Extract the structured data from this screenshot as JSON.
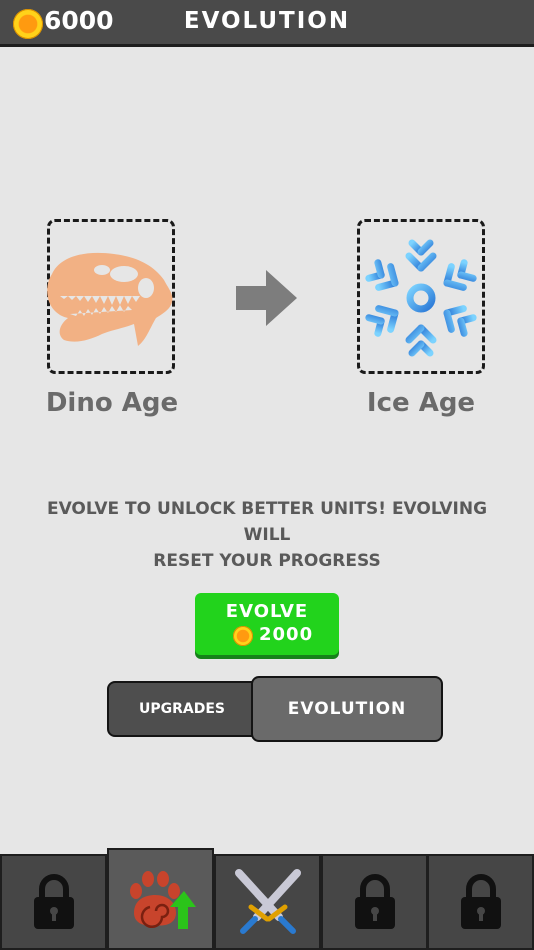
{
  "header": {
    "coins": "6000",
    "title": "EVOLUTION"
  },
  "evolution": {
    "current_age": "Dino Age",
    "next_age": "Ice Age",
    "message_line1": "EVOLVE TO UNLOCK BETTER UNITS! EVOLVING WILL",
    "message_line2": "RESET YOUR PROGRESS",
    "evolve_label": "EVOLVE",
    "evolve_cost": "2000"
  },
  "tabs": {
    "upgrades": "UPGRADES",
    "evolution": "EVOLUTION",
    "selected": "evolution"
  },
  "bottom_nav": [
    {
      "icon": "lock-icon",
      "locked": true
    },
    {
      "icon": "paw-upgrade-icon",
      "locked": false,
      "active": true
    },
    {
      "icon": "crossed-swords-icon",
      "locked": false
    },
    {
      "icon": "lock-icon",
      "locked": true
    },
    {
      "icon": "lock-icon",
      "locked": true
    }
  ],
  "colors": {
    "header": "#4a4a4a",
    "evolve_button": "#22d31c",
    "coin": "#ffb300"
  }
}
